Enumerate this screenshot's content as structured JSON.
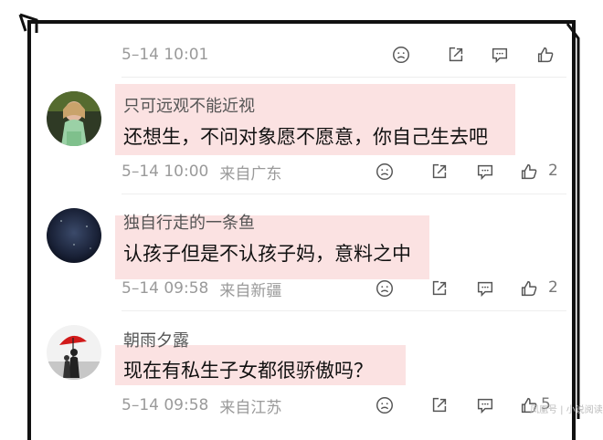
{
  "comments": [
    {
      "date": "5–14 10:01",
      "location": "",
      "likes": ""
    },
    {
      "username": "只可远观不能近视",
      "text": "还想生，不问对象愿不愿意，你自己生去吧",
      "date": "5–14 10:00",
      "location": "来自广东",
      "likes": "2"
    },
    {
      "username": "独自行走的一条鱼",
      "text": "认孩子但是不认孩子妈，意料之中",
      "date": "5–14 09:58",
      "location": "来自新疆",
      "likes": "2"
    },
    {
      "username": "朝雨夕露",
      "text": "现在有私生子女都很骄傲吗？",
      "date": "5–14 09:58",
      "location": "来自江苏",
      "likes": "5"
    }
  ],
  "icons": [
    "sad-face-icon",
    "share-icon",
    "comment-icon",
    "thumbs-up-icon"
  ],
  "colors": {
    "highlight": "#fbe2e2",
    "meta_text": "#9a9a9a",
    "frame": "#111111"
  },
  "watermark": "凤凰号 | 小说阅读"
}
